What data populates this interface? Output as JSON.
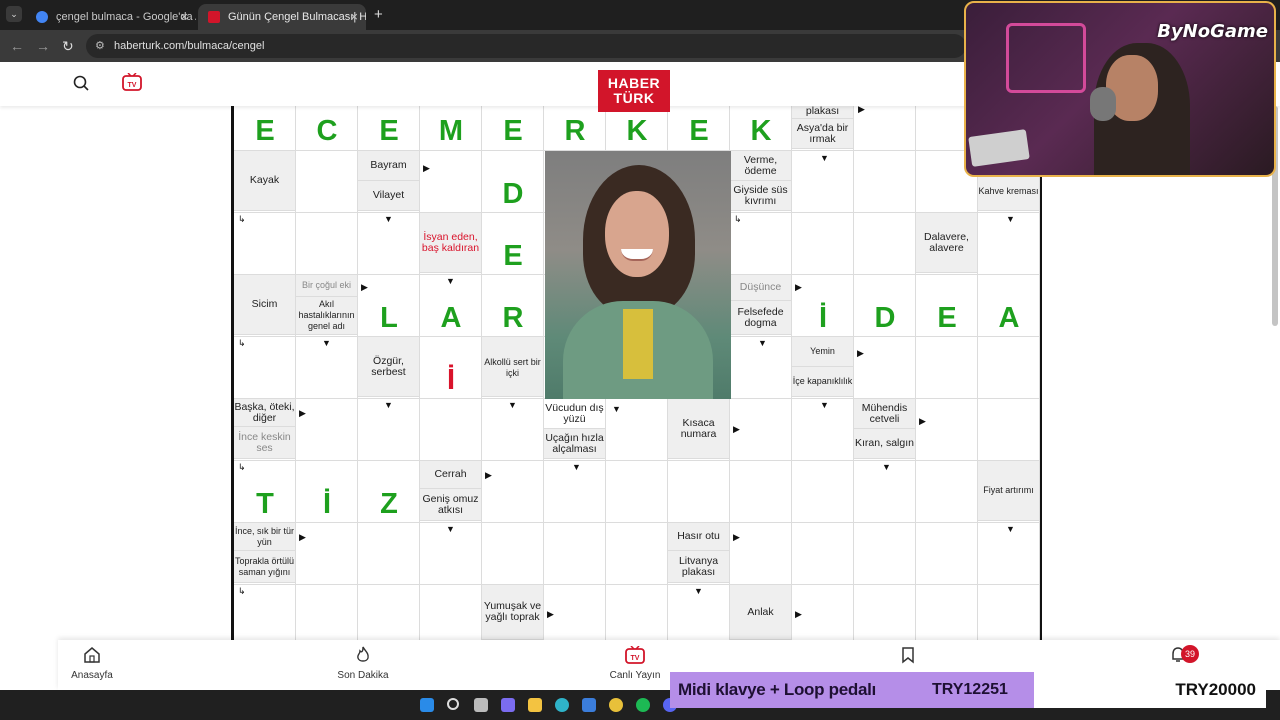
{
  "browser": {
    "tabs": [
      {
        "title": "çengel bulmaca - Google'da Ara",
        "favicon_color": "#4285f4"
      },
      {
        "title": "Günün Çengel Bulmacası| HT Bulm",
        "favicon_color": "#d2152a"
      }
    ],
    "url": "haberturk.com/bulmaca/cengel"
  },
  "site": {
    "logo_line1": "HABER",
    "logo_line2": "TÜRK",
    "tv_label": "TV",
    "brand_color": "#d2152a"
  },
  "puzzle": {
    "letter_color": "#1ea01e",
    "top_row_letters": [
      "E",
      "C",
      "E",
      "M",
      "E",
      "R",
      "K",
      "E",
      "K"
    ],
    "grid_letters": {
      "d": "D",
      "e": "E",
      "l": "L",
      "a": "A",
      "r": "R",
      "i1": "İ",
      "d2": "D",
      "e2": "E",
      "a2": "A",
      "i_red": "İ",
      "t": "T",
      "i2": "İ",
      "z": "Z"
    },
    "clues": {
      "plakasi": "plakası",
      "asya_irmak": "Asya'da bir ırmak",
      "kayak": "Kayak",
      "bayram": "Bayram",
      "vilayet": "Vilayet",
      "verme": "Verme, ödeme",
      "giyside": "Giyside süs kıvrımı",
      "kahve": "Kahve kreması",
      "isyan": "İsyan eden, baş kaldıran",
      "dalavere": "Dalavere, alavere",
      "sicim": "Sicim",
      "bir_cogul": "Bir çoğul eki",
      "akil": "Akıl hastalıklarının genel adı",
      "dusunce": "Düşünce",
      "felsefede": "Felsefede dogma",
      "ozgur": "Özgür, serbest",
      "alkollu": "Alkollü sert bir içki",
      "yemin": "Yemin",
      "ice": "İçe kapanıklılık",
      "baska": "Başka, öteki, diğer",
      "ince_keskin": "İnce keskin ses",
      "vucudun": "Vücudun dış yüzü",
      "ucagin": "Uçağın hızla alçalması",
      "kisaca": "Kısaca numara",
      "muhendis": "Mühendis cetveli",
      "kiran": "Kıran, salgın",
      "cerrah": "Cerrah",
      "genis": "Geniş omuz atkısı",
      "fiyat": "Fiyat artırımı",
      "ince_sik": "İnce, sık bir tür yün",
      "toprakla": "Toprakla örtülü saman yığını",
      "hasir": "Hasır otu",
      "litvanya": "Litvanya plakası",
      "yumusak": "Yumuşak ve yağlı toprak",
      "anlak": "Anlak"
    }
  },
  "bottom_nav": {
    "home": "Anasayfa",
    "latest": "Son Dakika",
    "live": "Canlı Yayın",
    "notif_count": "39"
  },
  "stream": {
    "brand": "ByNoGame",
    "donation_title": "Midi klavye + Loop pedalı",
    "donation_current": "TRY12251",
    "donation_goal": "TRY20000",
    "donation_fill_fraction": 0.61
  }
}
